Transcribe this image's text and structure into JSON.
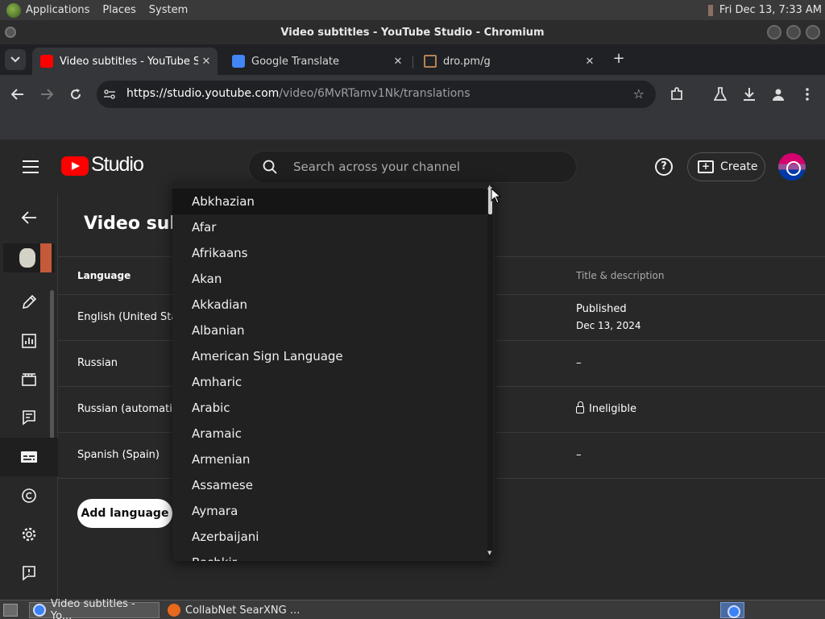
{
  "system_panel": {
    "menus": [
      "Applications",
      "Places",
      "System"
    ],
    "clock": "Fri Dec 13,  7:33 AM"
  },
  "window": {
    "title": "Video subtitles - YouTube Studio - Chromium"
  },
  "tabs": [
    {
      "title": "Video subtitles - YouTube Studio",
      "favicon_color": "#ff0000",
      "active": true
    },
    {
      "title": "Google Translate",
      "favicon_color": "#4285f4",
      "active": false
    },
    {
      "title": "dro.pm/g",
      "favicon_color": "#b5835a",
      "active": false
    }
  ],
  "toolbar": {
    "url_host": "https://studio.youtube.com",
    "url_path": "/video/6MvRTamv1Nk/translations"
  },
  "header": {
    "brand": "Studio",
    "search_placeholder": "Search across your channel",
    "help_label": "?",
    "create_label": "Create"
  },
  "page": {
    "title": "Video subt"
  },
  "table": {
    "headers": {
      "language": "Language",
      "title_desc": "Title & description"
    },
    "rows": [
      {
        "language": "English (United State",
        "title": "Published",
        "sub": "Dec 13, 2024"
      },
      {
        "language": "Russian",
        "title": "–",
        "sub": ""
      },
      {
        "language": "Russian (automatic c",
        "title": "Ineligible",
        "sub": "",
        "lock": true
      },
      {
        "language": "Spanish (Spain)",
        "title": "–",
        "sub": ""
      }
    ]
  },
  "add_language_label": "Add language",
  "dropdown": {
    "items": [
      "Abkhazian",
      "Afar",
      "Afrikaans",
      "Akan",
      "Akkadian",
      "Albanian",
      "American Sign Language",
      "Amharic",
      "Arabic",
      "Aramaic",
      "Armenian",
      "Assamese",
      "Aymara",
      "Azerbaijani",
      "Bashkir"
    ],
    "highlighted_index": 0
  },
  "taskbar": {
    "items": [
      {
        "title": "Video subtitles - Yo...",
        "active": true,
        "favicon_color": "#3b82f6"
      },
      {
        "title": "CollabNet SearXNG ...",
        "active": false,
        "favicon_color": "#e8681c"
      }
    ]
  }
}
